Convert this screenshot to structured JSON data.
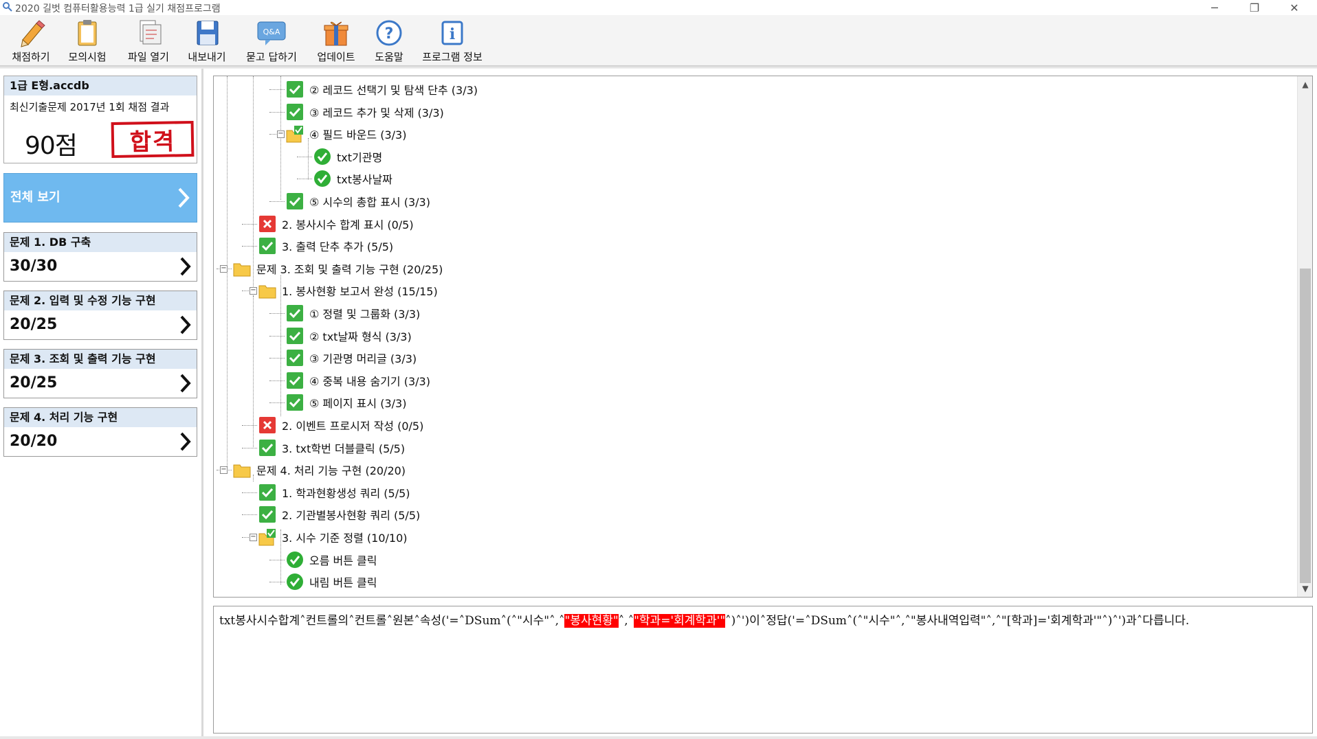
{
  "window": {
    "title": "2020 길벗 컴퓨터활용능력 1급 실기 채점프로그램",
    "controls": [
      "─",
      "❐",
      "✕"
    ]
  },
  "toolbar": {
    "buttons": [
      {
        "label": "채점하기",
        "icon": "pencil-icon"
      },
      {
        "label": "모의시험",
        "icon": "clipboard-icon"
      },
      {
        "label": "파일 열기",
        "icon": "open-file-icon"
      },
      {
        "label": "내보내기",
        "icon": "save-disk-icon"
      },
      {
        "label": "묻고 답하기",
        "icon": "qa-bubble-icon",
        "badge": "Q&A"
      },
      {
        "label": "업데이트",
        "icon": "gift-box-icon"
      },
      {
        "label": "도움말",
        "icon": "help-question-icon",
        "glyph": "?"
      },
      {
        "label": "프로그램 정보",
        "icon": "info-icon",
        "glyph": "i"
      }
    ]
  },
  "summary": {
    "file_name": "1급 E형.accdb",
    "subtitle": "최신기출문제 2017년 1회 채점 결과",
    "score": "90점",
    "result_stamp": "합격"
  },
  "view_all": {
    "label": "전체 보기"
  },
  "problems": [
    {
      "title": "문제 1. DB 구축",
      "score": "30/30"
    },
    {
      "title": "문제 2. 입력 및 수정 기능 구현",
      "score": "20/25"
    },
    {
      "title": "문제 3. 조회 및 출력 기능 구현",
      "score": "20/25"
    },
    {
      "title": "문제 4. 처리 기능 구현",
      "score": "20/20"
    }
  ],
  "tree": {
    "rows": [
      {
        "label": "② 레코드 선택기 및 탐색 단추 (3/3)",
        "icon": "check-square"
      },
      {
        "label": "③ 레코드 추가 및 삭제 (3/3)",
        "icon": "check-square"
      },
      {
        "label": "④ 필드 바운드 (3/3)",
        "icon": "check-folder"
      },
      {
        "label": "txt기관명",
        "icon": "check-circle"
      },
      {
        "label": "txt봉사날짜",
        "icon": "check-circle"
      },
      {
        "label": "⑤ 시수의 총합 표시 (3/3)",
        "icon": "check-square"
      },
      {
        "label": "2. 봉사시수 합계 표시 (0/5)",
        "icon": "x-square"
      },
      {
        "label": "3. 출력 단추 추가 (5/5)",
        "icon": "check-square"
      },
      {
        "label": "문제 3. 조회 및 출력 기능 구현 (20/25)",
        "icon": "folder"
      },
      {
        "label": "1. 봉사현황 보고서 완성 (15/15)",
        "icon": "folder"
      },
      {
        "label": "① 정렬 및 그룹화 (3/3)",
        "icon": "check-square"
      },
      {
        "label": "② txt날짜 형식 (3/3)",
        "icon": "check-square"
      },
      {
        "label": "③ 기관명 머리글 (3/3)",
        "icon": "check-square"
      },
      {
        "label": "④ 중복 내용 숨기기 (3/3)",
        "icon": "check-square"
      },
      {
        "label": "⑤ 페이지 표시 (3/3)",
        "icon": "check-square"
      },
      {
        "label": "2. 이벤트 프로시저 작성 (0/5)",
        "icon": "x-square"
      },
      {
        "label": "3. txt학번 더블클릭 (5/5)",
        "icon": "check-square"
      },
      {
        "label": "문제 4. 처리 기능 구현 (20/20)",
        "icon": "folder"
      },
      {
        "label": "1. 학과현황생성 쿼리 (5/5)",
        "icon": "check-square"
      },
      {
        "label": "2. 기관별봉사현황 쿼리 (5/5)",
        "icon": "check-square"
      },
      {
        "label": "3. 시수 기준 정렬 (10/10)",
        "icon": "check-folder"
      },
      {
        "label": "오름 버튼 클릭",
        "icon": "check-circle"
      },
      {
        "label": "내림 버튼 클릭",
        "icon": "check-circle"
      }
    ]
  },
  "message": {
    "p1": "txt봉사시수합계˄컨트롤의˄컨트롤˄원본˄속성('=˄DSum˄(˄\"시수\"˄,˄",
    "h1": "\"봉사현황\"",
    "p2": "˄,˄",
    "h2": "\"학과='회계학과'\"",
    "p3": "˄)˄')이˄정답('=˄DSum˄(˄\"시수\"˄,˄\"봉사내역입력\"˄,˄\"[학과]='회계학과'\"˄)˄')과˄다릅니다."
  },
  "colors": {
    "accent": "#6fb9ef",
    "check_green": "#3cb043",
    "error_red": "#e53935",
    "folder_yellow": "#f7c948",
    "stamp_red": "#d0101b",
    "card_header": "#dde8f4"
  }
}
